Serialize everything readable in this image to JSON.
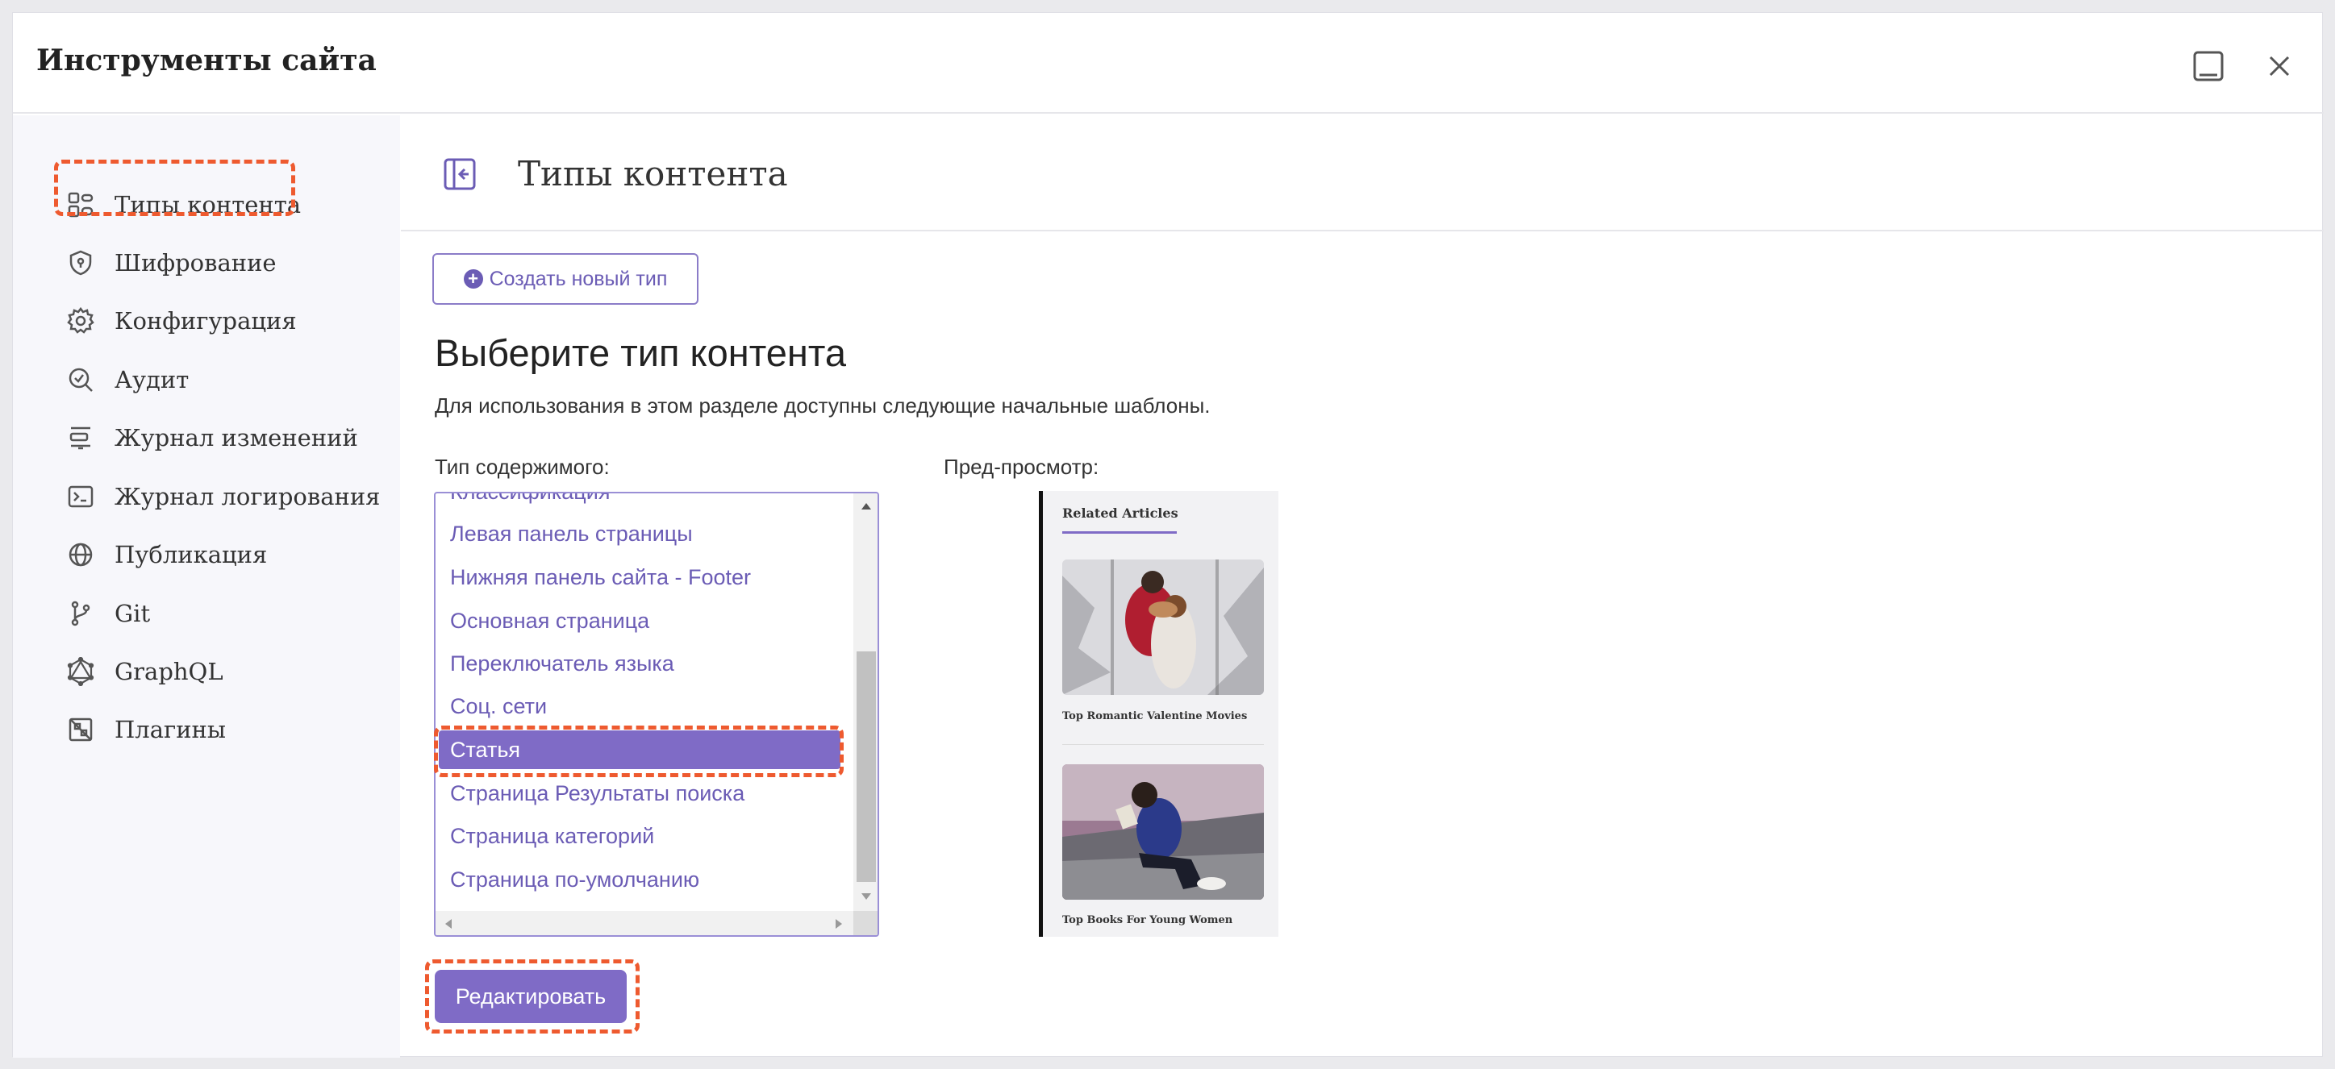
{
  "window": {
    "title": "Инструменты сайта",
    "minimize_icon": "minimize-icon",
    "close_icon": "close-icon"
  },
  "sidebar": {
    "items": [
      {
        "label": "Типы контента",
        "icon": "content-types-icon"
      },
      {
        "label": "Шифрование",
        "icon": "shield-icon"
      },
      {
        "label": "Конфигурация",
        "icon": "gear-icon"
      },
      {
        "label": "Аудит",
        "icon": "audit-icon"
      },
      {
        "label": "Журнал изменений",
        "icon": "changelog-icon"
      },
      {
        "label": "Журнал логирования",
        "icon": "terminal-icon"
      },
      {
        "label": "Публикация",
        "icon": "globe-icon"
      },
      {
        "label": "Git",
        "icon": "git-branch-icon"
      },
      {
        "label": "GraphQL",
        "icon": "graphql-icon"
      },
      {
        "label": "Плагины",
        "icon": "plugin-icon"
      }
    ]
  },
  "main": {
    "title": "Типы контента",
    "create_button": "Создать новый тип",
    "heading": "Выберите тип контента",
    "description": "Для использования в этом разделе доступны следующие начальные шаблоны.",
    "type_label": "Тип содержимого:",
    "preview_label": "Пред-просмотр:",
    "content_types": [
      "Классификация",
      "Левая панель страницы",
      "Нижняя панель сайта - Footer",
      "Основная страница",
      "Переключатель языка",
      "Соц. сети",
      "Статья",
      "Страница Результаты поиска",
      "Страница категорий",
      "Страница по-умолчанию"
    ],
    "selected_type": "Статья",
    "edit_button": "Редактировать"
  },
  "preview": {
    "heading": "Related Articles",
    "articles": [
      {
        "caption": "Top Romantic Valentine Movies",
        "image": "couple-in-snow-photo"
      },
      {
        "caption": "Top Books For Young Women",
        "image": "woman-reading-photo"
      }
    ]
  },
  "colors": {
    "accent": "#7f6bc6",
    "link": "#6b5cb5",
    "highlight": "#ee5a2f"
  }
}
